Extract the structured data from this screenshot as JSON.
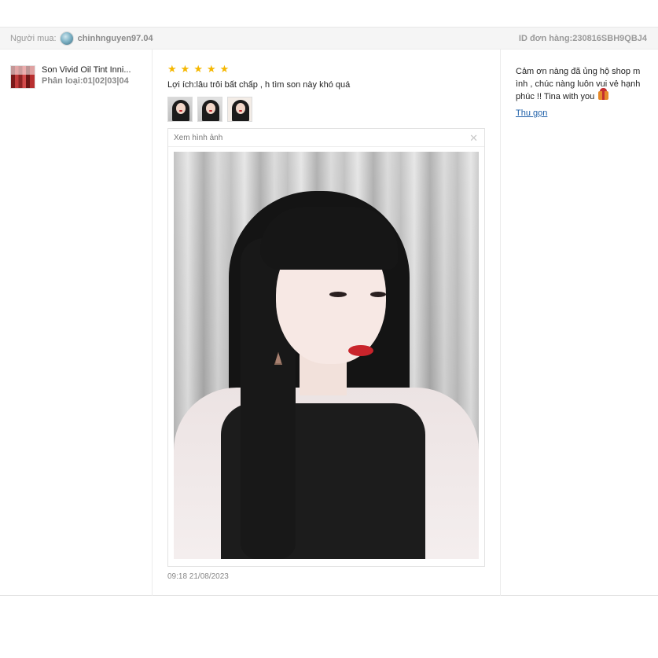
{
  "header": {
    "buyer_label": "Người mua:",
    "buyer_name": "chinhnguyen97.04",
    "order_id": "ID đơn hàng:230816SBH9QBJ4"
  },
  "product": {
    "name": "Son Vivid Oil Tint Inni...",
    "variant": "Phân loại:01|02|03|04"
  },
  "review": {
    "rating": 5,
    "stars": [
      "★",
      "★",
      "★",
      "★",
      "★"
    ],
    "text": "Lợi ích:lâu trôi bất chấp , h tìm son này khó quá",
    "thumbnails": [
      "photo-1",
      "photo-2",
      "photo-3"
    ],
    "viewer_title": "Xem hình ảnh",
    "close_symbol": "✕",
    "timestamp": "09:18 21/08/2023"
  },
  "reply": {
    "text": "Cảm ơn nàng đã ủng hộ shop m ình , chúc nàng luôn vui vẻ hạnh phúc !! Tina with you",
    "emoji_icon": "gift-icon",
    "collapse_label": "Thu gọn"
  },
  "colors": {
    "star": "#f5b700",
    "link": "#1d5fa8",
    "header_bg": "#f5f5f5"
  }
}
